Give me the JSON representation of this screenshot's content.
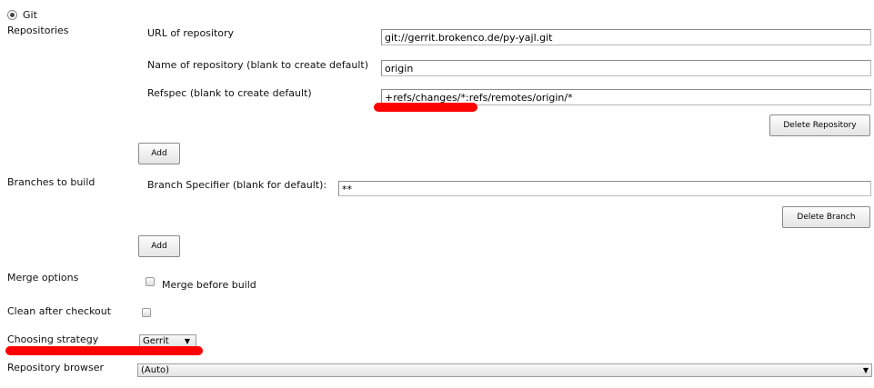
{
  "scm": {
    "label": "Git"
  },
  "repositories": {
    "section_label": "Repositories",
    "url_label": "URL of repository",
    "url_value": "git://gerrit.brokenco.de/py-yajl.git",
    "name_label": "Name of repository (blank to create default)",
    "name_value": "origin",
    "refspec_label": "Refspec (blank to create default)",
    "refspec_value": "+refs/changes/*:refs/remotes/origin/*",
    "delete_label": "Delete Repository",
    "add_label": "Add"
  },
  "branches": {
    "section_label": "Branches to build",
    "specifier_label": "Branch Specifier (blank for default):",
    "specifier_value": "**",
    "delete_label": "Delete Branch",
    "add_label": "Add"
  },
  "merge": {
    "section_label": "Merge options",
    "checkbox_label": "Merge before build",
    "checked": false
  },
  "clean": {
    "section_label": "Clean after checkout",
    "checked": false
  },
  "strategy": {
    "section_label": "Choosing strategy",
    "selected": "Gerrit"
  },
  "browser": {
    "section_label": "Repository browser",
    "selected": "(Auto)"
  },
  "colors": {
    "annotation": "#ff0000"
  }
}
